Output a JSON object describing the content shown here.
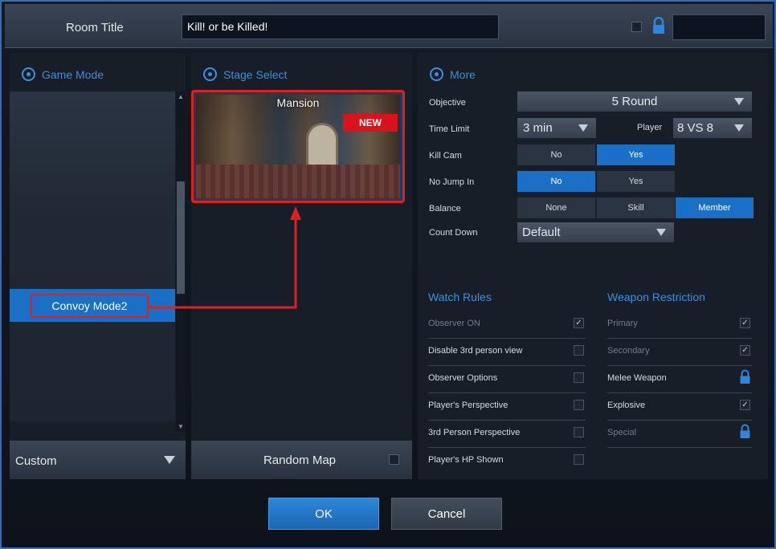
{
  "header": {
    "room_title_label": "Room Title",
    "room_title_value": "Kill! or be Killed!",
    "password_value": ""
  },
  "game_mode": {
    "title": "Game Mode",
    "selected_item": "Convoy Mode2",
    "dropdown_value": "Custom"
  },
  "stage_select": {
    "title": "Stage Select",
    "map_name": "Mansion",
    "badge": "NEW",
    "random_map_label": "Random Map"
  },
  "more": {
    "title": "More",
    "objective_label": "Objective",
    "objective_value": "5 Round",
    "time_limit_label": "Time Limit",
    "time_limit_value": "3 min",
    "player_label": "Player",
    "player_value": "8 VS 8",
    "kill_cam_label": "Kill Cam",
    "kill_cam_options": [
      "No",
      "Yes"
    ],
    "kill_cam_selected": "Yes",
    "no_jump_in_label": "No Jump In",
    "no_jump_in_options": [
      "No",
      "Yes"
    ],
    "no_jump_in_selected": "No",
    "balance_label": "Balance",
    "balance_options": [
      "None",
      "Skill",
      "Member"
    ],
    "balance_selected": "Member",
    "count_down_label": "Count Down",
    "count_down_value": "Default"
  },
  "watch_rules": {
    "title": "Watch Rules",
    "items": [
      {
        "label": "Observer ON",
        "checked": true,
        "disabled": true
      },
      {
        "label": "Disable 3rd person view",
        "checked": false,
        "disabled": false
      },
      {
        "label": "Observer Options",
        "checked": false,
        "disabled": false
      },
      {
        "label": "Player's Perspective",
        "checked": false,
        "disabled": false
      },
      {
        "label": "3rd Person Perspective",
        "checked": false,
        "disabled": false
      },
      {
        "label": "Player's HP Shown",
        "checked": false,
        "disabled": false
      }
    ]
  },
  "weapon_restriction": {
    "title": "Weapon Restriction",
    "items": [
      {
        "label": "Primary",
        "state": "checked",
        "disabled": true
      },
      {
        "label": "Secondary",
        "state": "checked",
        "disabled": true
      },
      {
        "label": "Melee Weapon",
        "state": "locked",
        "disabled": false
      },
      {
        "label": "Explosive",
        "state": "checked",
        "disabled": false
      },
      {
        "label": "Special",
        "state": "locked",
        "disabled": true
      }
    ]
  },
  "footer": {
    "ok_label": "OK",
    "cancel_label": "Cancel"
  },
  "colors": {
    "accent": "#1a70c6",
    "highlight_border": "#e02020",
    "title_blue": "#3c8ee0"
  }
}
